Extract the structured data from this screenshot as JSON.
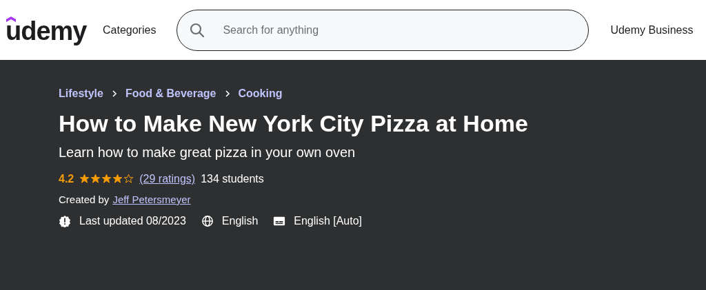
{
  "header": {
    "logo": "udemy",
    "nav": "Categories",
    "search": {
      "placeholder": "Search for anything"
    },
    "business_link": "Udemy Business"
  },
  "breadcrumbs": [
    "Lifestyle",
    "Food & Beverage",
    "Cooking"
  ],
  "course": {
    "title": "How to Make New York City Pizza at Home",
    "subtitle": "Learn how to make great pizza in your own oven",
    "rating": "4.2",
    "stars": 4,
    "ratings_link": "(29 ratings)",
    "students": "134 students",
    "created_by": "Created by",
    "instructor": "Jeff Petersmeyer",
    "meta": [
      {
        "kind": "updated",
        "text": "Last updated 08/2023"
      },
      {
        "kind": "language",
        "text": "English"
      },
      {
        "kind": "captions",
        "text": "English [Auto]"
      }
    ]
  }
}
